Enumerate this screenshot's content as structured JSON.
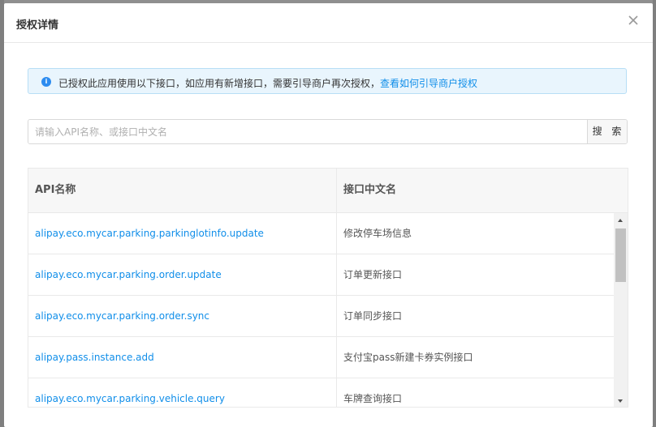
{
  "modal": {
    "title": "授权详情",
    "close_icon": "close-icon"
  },
  "notice": {
    "icon": "info-icon",
    "icon_glyph": "i",
    "text": "已授权此应用使用以下接口，如应用有新增接口，需要引导商户再次授权，",
    "link_text": "查看如何引导商户授权"
  },
  "search": {
    "placeholder": "请输入API名称、或接口中文名",
    "value": "",
    "button_label": "搜 索"
  },
  "table": {
    "columns": [
      "API名称",
      "接口中文名"
    ],
    "rows": [
      {
        "api": "alipay.eco.mycar.parking.parkinglotinfo.update",
        "name": "修改停车场信息"
      },
      {
        "api": "alipay.eco.mycar.parking.order.update",
        "name": "订单更新接口"
      },
      {
        "api": "alipay.eco.mycar.parking.order.sync",
        "name": "订单同步接口"
      },
      {
        "api": "alipay.pass.instance.add",
        "name": "支付宝pass新建卡券实例接口"
      },
      {
        "api": "alipay.eco.mycar.parking.vehicle.query",
        "name": "车牌查询接口"
      }
    ]
  },
  "colors": {
    "link": "#108ee9",
    "notice_bg": "#e9f5fd",
    "notice_border": "#b7def6",
    "info_icon": "#2d8cf0"
  }
}
